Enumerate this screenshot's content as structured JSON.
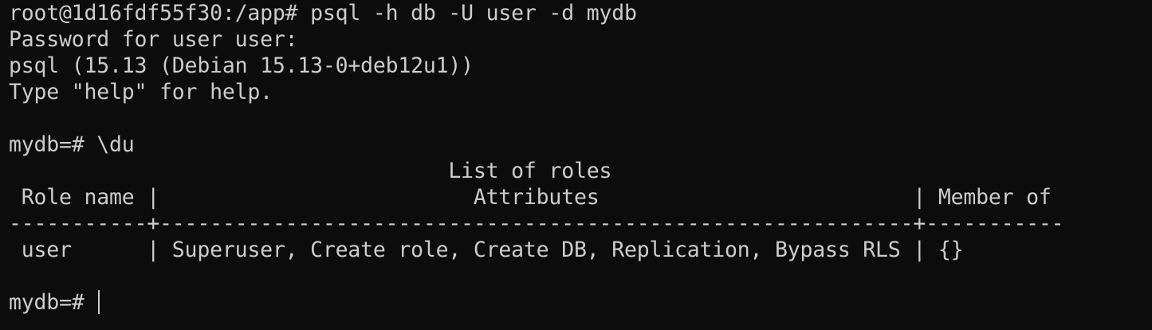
{
  "terminal": {
    "lines": [
      "root@1d16fdf55f30:/app# psql -h db -U user -d mydb",
      "Password for user user:",
      "psql (15.13 (Debian 15.13-0+deb12u1))",
      "Type \"help\" for help.",
      "",
      "mydb=# \\du",
      "                                   List of roles",
      " Role name |                         Attributes                         | Member of",
      "-----------+------------------------------------------------------------+-----------",
      " user      | Superuser, Create role, Create DB, Replication, Bypass RLS | {}",
      ""
    ],
    "prompt": "mydb=# "
  },
  "colors": {
    "background": "#0c0c0c",
    "foreground": "#cccccc"
  }
}
